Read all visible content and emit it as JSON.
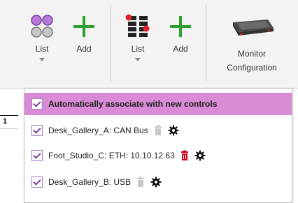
{
  "ribbon": {
    "group1": {
      "list_label": "List",
      "add_label": "Add"
    },
    "group2": {
      "list_label": "List",
      "add_label": "Add"
    },
    "monitor": {
      "line1": "Monitor",
      "line2": "Configuration"
    }
  },
  "left_strip": {
    "text": "1"
  },
  "dropdown": {
    "items": [
      {
        "label": "Automatically associate with new controls",
        "checked": true
      },
      {
        "label": "Desk_Gallery_A: CAN Bus",
        "checked": true,
        "delete_color": "#c8c8c8"
      },
      {
        "label": "Foot_Studio_C: ETH: 10.10.12.63",
        "checked": true,
        "delete_color": "#d0021b"
      },
      {
        "label": "Desk_Gallery_B: USB",
        "checked": true,
        "delete_color": "#c8c8c8"
      }
    ]
  },
  "colors": {
    "highlight": "#d98bd6",
    "add_plus": "#2e9e2e",
    "red_dot": "#e0202a"
  }
}
